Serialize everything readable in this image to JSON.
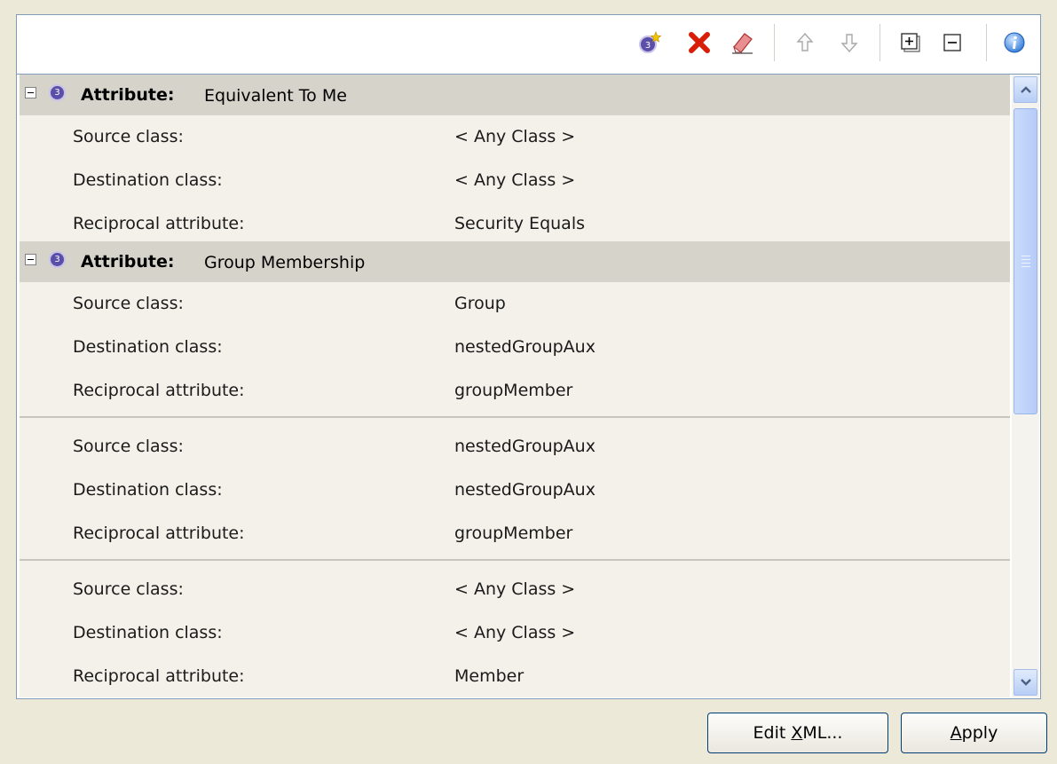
{
  "toolbar": {
    "icons": [
      "add-attribute-icon",
      "delete-icon",
      "eraser-icon",
      "move-up-icon",
      "move-down-icon",
      "expand-all-icon",
      "collapse-all-icon",
      "info-icon"
    ]
  },
  "groups": [
    {
      "label": "Attribute:",
      "name": "Equivalent To Me",
      "badge": "3",
      "entries": [
        {
          "source_label": "Source class:",
          "source_value": "< Any Class >",
          "dest_label": "Destination class:",
          "dest_value": "< Any Class >",
          "recip_label": "Reciprocal attribute:",
          "recip_value": "Security Equals"
        }
      ]
    },
    {
      "label": "Attribute:",
      "name": "Group Membership",
      "badge": "3",
      "entries": [
        {
          "source_label": "Source class:",
          "source_value": "Group",
          "dest_label": "Destination class:",
          "dest_value": "nestedGroupAux",
          "recip_label": "Reciprocal attribute:",
          "recip_value": "groupMember"
        },
        {
          "source_label": "Source class:",
          "source_value": "nestedGroupAux",
          "dest_label": "Destination class:",
          "dest_value": "nestedGroupAux",
          "recip_label": "Reciprocal attribute:",
          "recip_value": "groupMember"
        },
        {
          "source_label": "Source class:",
          "source_value": "< Any Class >",
          "dest_label": "Destination class:",
          "dest_value": "< Any Class >",
          "recip_label": "Reciprocal attribute:",
          "recip_value": "Member"
        }
      ]
    }
  ],
  "buttons": {
    "edit_xml_pre": "Edit ",
    "edit_xml_mnemonic": "X",
    "edit_xml_post": "ML...",
    "apply_mnemonic": "A",
    "apply_post": "pply"
  }
}
